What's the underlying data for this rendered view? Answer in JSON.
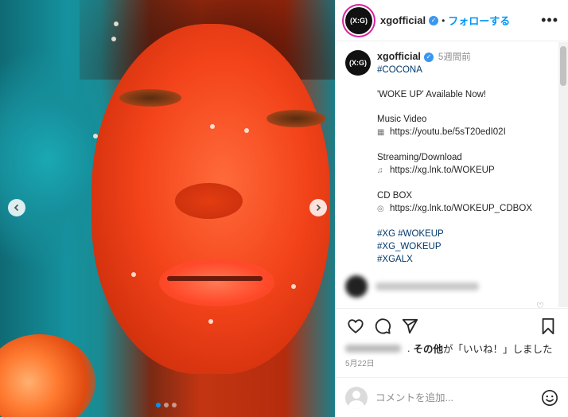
{
  "post": {
    "carousel": {
      "slide_count": 3,
      "active_index": 0
    }
  },
  "header": {
    "avatar_text": "(X:G)",
    "username": "xgofficial",
    "separator": "•",
    "follow_label": "フォローする",
    "more_icon": "more-horizontal-icon"
  },
  "caption": {
    "username": "xgofficial",
    "time": "5週間前",
    "tag_member": "#COCONA",
    "line_available": "'WOKE UP' Available Now!",
    "mv_title": "Music Video",
    "mv_link": "https://youtu.be/5sT20edI02I",
    "stream_title": "Streaming/Download",
    "stream_link": "https://xg.lnk.to/WOKEUP",
    "cd_title": "CD BOX",
    "cd_link": "https://xg.lnk.to/WOKEUP_CDBOX",
    "tags": [
      "#XG #WOKEUP",
      "#XG_WOKEUP",
      "#XGALX"
    ]
  },
  "likes": {
    "suffix_bold": "その他",
    "suffix_text": "が「いいね！」しました"
  },
  "date": "5月22日",
  "comment": {
    "placeholder": "コメントを追加..."
  },
  "colors": {
    "accent": "#0095f6",
    "hashtag": "#00376b",
    "verified": "#3897f0",
    "muted": "#8e8e8e"
  }
}
